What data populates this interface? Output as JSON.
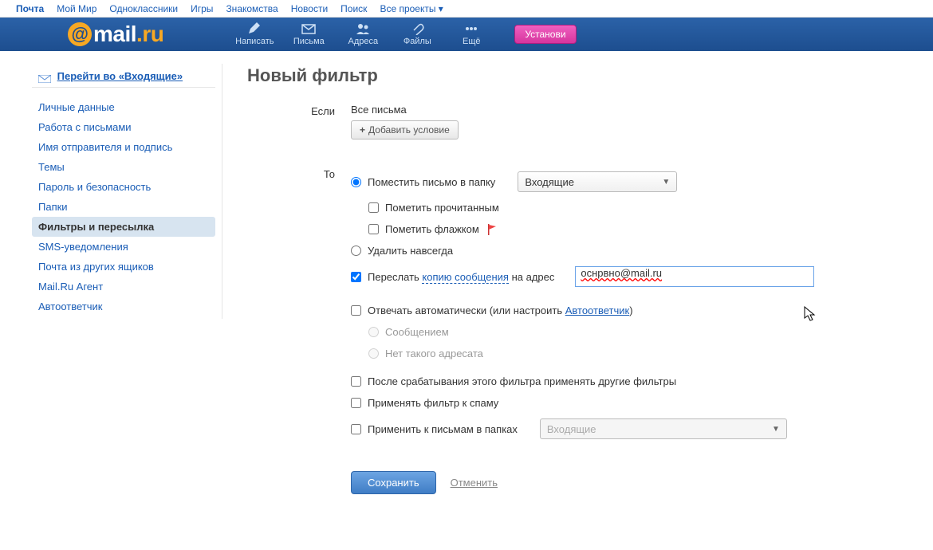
{
  "topnav": [
    "Почта",
    "Мой Мир",
    "Одноклассники",
    "Игры",
    "Знакомства",
    "Новости",
    "Поиск",
    "Все проекты ▾"
  ],
  "logo": {
    "at": "@",
    "main": "mail",
    "dot": ".",
    "ru": "ru"
  },
  "navicons": [
    {
      "label": "Написать"
    },
    {
      "label": "Письма"
    },
    {
      "label": "Адреса"
    },
    {
      "label": "Файлы"
    },
    {
      "label": "Ещё"
    }
  ],
  "install": "Установи",
  "goto_inbox": "Перейти во «Входящие»",
  "sidebar": [
    "Личные данные",
    "Работа с письмами",
    "Имя отправителя и подпись",
    "Темы",
    "Пароль и безопасность",
    "Папки",
    "Фильтры и пересылка",
    "SMS-уведомления",
    "Почта из других ящиков",
    "Mail.Ru Агент",
    "Автоответчик"
  ],
  "sidebar_active": 6,
  "title": "Новый фильтр",
  "labels": {
    "if": "Если",
    "then": "То"
  },
  "all_letters": "Все письма",
  "add_condition": "Добавить условие",
  "actions": {
    "move": "Поместить письмо в папку",
    "folder": "Входящие",
    "mark_read": "Пометить прочитанным",
    "mark_flag": "Пометить флажком",
    "delete": "Удалить навсегда",
    "forward_pre": "Переслать ",
    "forward_link": "копию сообщения",
    "forward_post": " на адрес",
    "forward_value": "оснрвно@mail.ru",
    "autoreply_pre": "Отвечать автоматически (или настроить ",
    "autoreply_link": "Автоответчик",
    "autoreply_post": ")",
    "autoreply_msg": "Сообщением",
    "autoreply_noaddr": "Нет такого адресата",
    "after": "После срабатывания этого фильтра применять другие фильтры",
    "spam": "Применять фильтр к спаму",
    "apply_folders": "Применить к письмам в папках",
    "apply_folder_value": "Входящие"
  },
  "buttons": {
    "save": "Сохранить",
    "cancel": "Отменить"
  }
}
